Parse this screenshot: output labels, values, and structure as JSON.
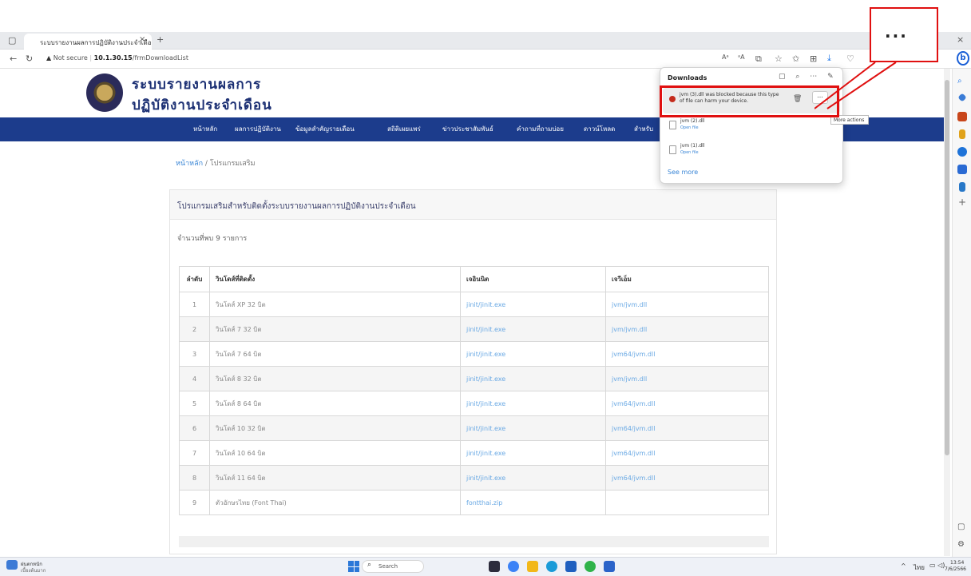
{
  "browser": {
    "tab_title": "ระบบรายงานผลการปฏิบัติงานประจำเดือน",
    "tab_close": "×",
    "new_tab": "+",
    "not_secure": "Not secure",
    "url_host": "10.1.30.15",
    "url_path": "/frmDownloadList",
    "window_close": "×",
    "window_restore": "❐"
  },
  "site": {
    "title_line1": "ระบบรายงานผลการ",
    "title_line2": "ปฏิบัติงานประจำเดือน"
  },
  "nav": {
    "items": [
      "หน้าหลัก",
      "ผลการปฏิบัติงาน",
      "ข้อมูลสำคัญรายเดือน",
      "สถิติเผยแพร่",
      "ข่าวประชาสัมพันธ์",
      "คำถามที่ถามบ่อย",
      "ดาวน์โหลด",
      "สำหรับ"
    ]
  },
  "breadcrumb": {
    "home": "หน้าหลัก",
    "sep": " / ",
    "current": "โปรแกรมเสริม"
  },
  "panel": {
    "title": "โปรแกรมเสริมสำหรับติดตั้งระบบรายงานผลการปฏิบัติงานประจำเดือน",
    "found_count": "จำนวนที่พบ 9 รายการ"
  },
  "table": {
    "headers": [
      "ลำดับ",
      "วินโดส์ที่ติดตั้ง",
      "เจอินนิต",
      "เจวีเอ็ม"
    ],
    "rows": [
      [
        "1",
        "วินโดส์ XP 32 บิต",
        "jinit/jinit.exe",
        "jvm/jvm.dll"
      ],
      [
        "2",
        "วินโดส์ 7 32 บิต",
        "jinit/jinit.exe",
        "jvm/jvm.dll"
      ],
      [
        "3",
        "วินโดส์ 7 64 บิต",
        "jinit/jinit.exe",
        "jvm64/jvm.dll"
      ],
      [
        "4",
        "วินโดส์ 8 32 บิต",
        "jinit/jinit.exe",
        "jvm/jvm.dll"
      ],
      [
        "5",
        "วินโดส์ 8 64 บิต",
        "jinit/jinit.exe",
        "jvm64/jvm.dll"
      ],
      [
        "6",
        "วินโดส์ 10 32 บิต",
        "jinit/jinit.exe",
        "jvm64/jvm.dll"
      ],
      [
        "7",
        "วินโดส์ 10 64 บิต",
        "jinit/jinit.exe",
        "jvm64/jvm.dll"
      ],
      [
        "8",
        "วินโดส์ 11 64 บิต",
        "jinit/jinit.exe",
        "jvm64/jvm.dll"
      ],
      [
        "9",
        "ตัวอักษรไทย (Font Thai)",
        "fontthai.zip",
        ""
      ]
    ]
  },
  "downloads": {
    "title": "Downloads",
    "header_icons": "▢ ⌕ ⋯ ✎",
    "blocked_text": "jvm (3).dll was blocked because this type of file can harm your device.",
    "trash": "🗑",
    "more_label": "...",
    "tooltip": "More actions",
    "files": [
      {
        "name": "jvm (2).dll",
        "action": "Open file"
      },
      {
        "name": "jvm (1).dll",
        "action": "Open file"
      }
    ],
    "see_more": "See more"
  },
  "zoom_callout": {
    "dots": "..."
  },
  "taskbar": {
    "weather_label1": "ฝนตกหนัก",
    "weather_label2": "เบื้องต้นมาก",
    "search": "Search",
    "time": "13:54",
    "date": "7/6/2566",
    "lang": "ไทย"
  },
  "colors": {
    "navbar": "#1c3c8c",
    "title": "#1b2f73",
    "link": "#6aa9e4",
    "annotation_red": "#e01010"
  }
}
